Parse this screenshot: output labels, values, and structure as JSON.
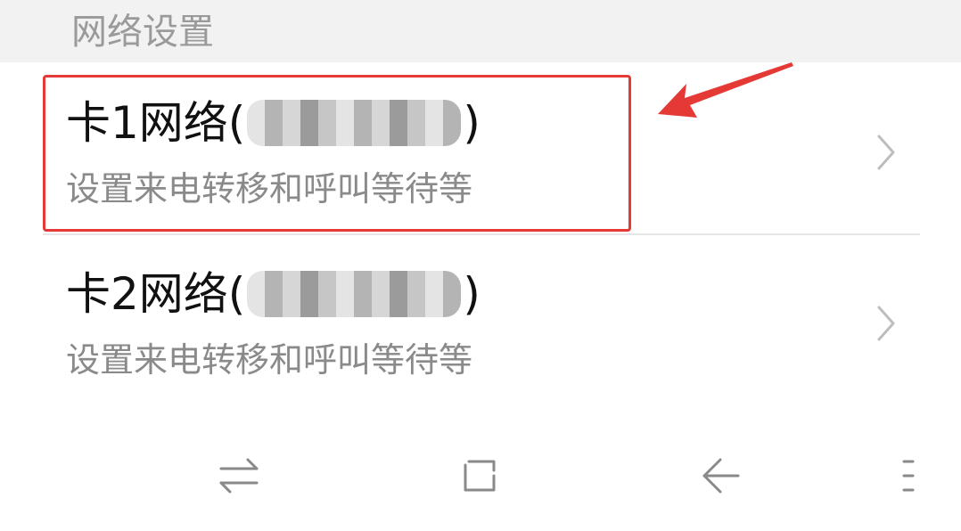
{
  "section": {
    "title": "网络设置"
  },
  "rows": [
    {
      "title_prefix": "卡1网络(",
      "title_suffix": ")",
      "subtitle": "设置来电转移和呼叫等待等"
    },
    {
      "title_prefix": "卡2网络(",
      "title_suffix": ")",
      "subtitle": "设置来电转移和呼叫等待等"
    }
  ],
  "icons": {
    "chevron": "chevron-right-icon",
    "switch": "switch-arrows-icon",
    "home": "square-home-icon",
    "back": "back-arrow-icon",
    "menu": "menu-dots-icon"
  },
  "colors": {
    "highlight": "#e53935",
    "header_bg": "#f2f2f2",
    "title_text": "#111111",
    "subtitle_text": "#8a8a8a"
  }
}
